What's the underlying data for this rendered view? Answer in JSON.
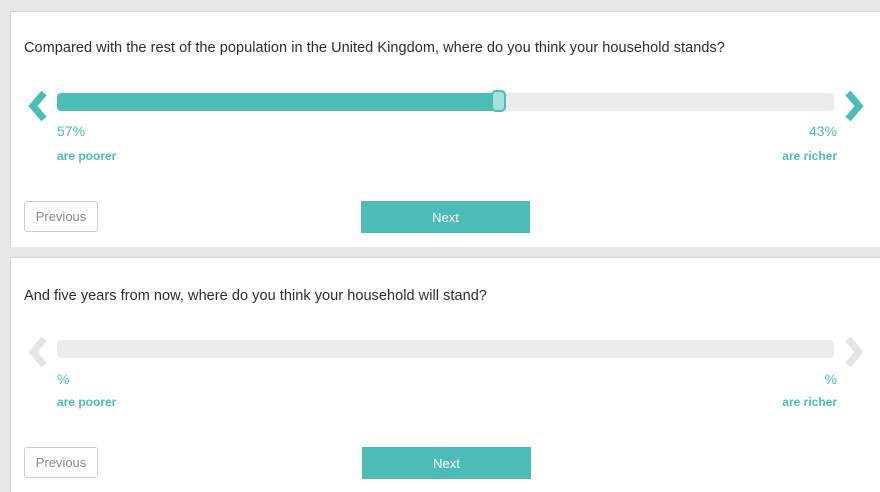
{
  "questions": [
    {
      "text": "Compared with the rest of the population in the United Kingdom, where do you think your household stands?",
      "slider_value_percent": 57,
      "left_percent": "57%",
      "left_caption": "are poorer",
      "right_percent": "43%",
      "right_caption": "are richer",
      "previous_label": "Previous",
      "next_label": "Next",
      "arrows_active": true
    },
    {
      "text": "And five years from now, where do you think your household will stand?",
      "slider_value_percent": null,
      "left_percent": "%",
      "left_caption": "are poorer",
      "right_percent": "%",
      "right_caption": "are richer",
      "previous_label": "Previous",
      "next_label": "Next",
      "arrows_active": false
    }
  ],
  "icons": {
    "left_arrow": "chevron-left-icon",
    "right_arrow": "chevron-right-icon"
  },
  "colors": {
    "accent": "#4bbdb6",
    "handle": "#a6e0db",
    "track": "#ececec",
    "arrow_inactive": "#e4e4e4",
    "background": "#e6e6e6"
  }
}
